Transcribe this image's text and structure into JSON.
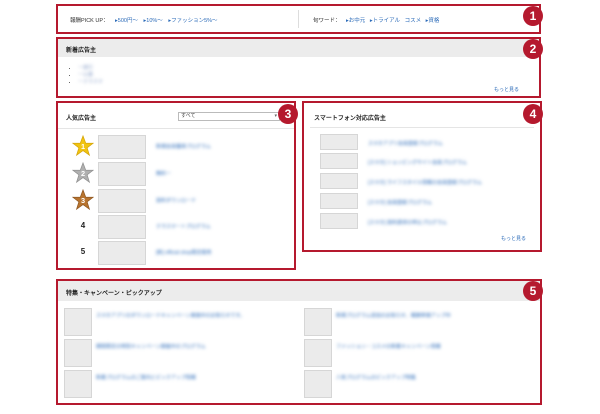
{
  "pickup": {
    "label": "報酬PICK UP：",
    "links": [
      "▸500円〜",
      "▸10%〜",
      "▸ファッション5%〜"
    ]
  },
  "keywords": {
    "label": "旬ワード：",
    "links": [
      "▸お中元",
      "▸トライアル",
      "コスメ",
      "▸資格"
    ]
  },
  "new_advertisers": {
    "title": "新着広告主",
    "items": [
      "ー旅行",
      "ー公募",
      "ークラスマ"
    ],
    "more": "もっと見る"
  },
  "popular": {
    "title": "人気広告主",
    "select_value": "すべて",
    "ranks": [
      {
        "rank": "1",
        "text": "新規会員獲得プログラム"
      },
      {
        "rank": "2",
        "text": "無料ー"
      },
      {
        "rank": "3",
        "text": "資料ダウンロード"
      },
      {
        "rank": "4",
        "text": "クラスマートプログラム"
      },
      {
        "rank": "5",
        "text": "[新] official shop限定販売"
      }
    ]
  },
  "smartphone": {
    "title": "スマートフォン対応広告主",
    "items": [
      "スマホアプリ会員登録プログラム",
      "[スマホ] ショッピングサイト会員プログラム",
      "[スマホ] ライフスタイル情報の会員登録プログラム",
      "[スマホ] 会員登録プログラム",
      "[スマホ] 資料請求の申込プログラム"
    ],
    "more": "もっと見る"
  },
  "features": {
    "title": "特集・キャンペーン・ピックアップ",
    "left": [
      "スマホアプリのダウンロードキャンペーン実施中のお知らせです。",
      "期間限定の特別キャンペーン開催中のプログラム",
      "新着プログラムのご案内とピックアップ情報"
    ],
    "right": [
      "新規プログラム追加のお知らせ、報酬単価アップ中",
      "ファッション・コスメの新着キャンペーン情報",
      "人気プログラムのピックアップ特集"
    ]
  },
  "badges": [
    "1",
    "2",
    "3",
    "4",
    "5"
  ],
  "colors": {
    "accent": "#b5192e",
    "link": "#2a6ab8",
    "gold": "#f1c40f",
    "silver": "#b0b0b0",
    "bronze": "#b8742f"
  }
}
